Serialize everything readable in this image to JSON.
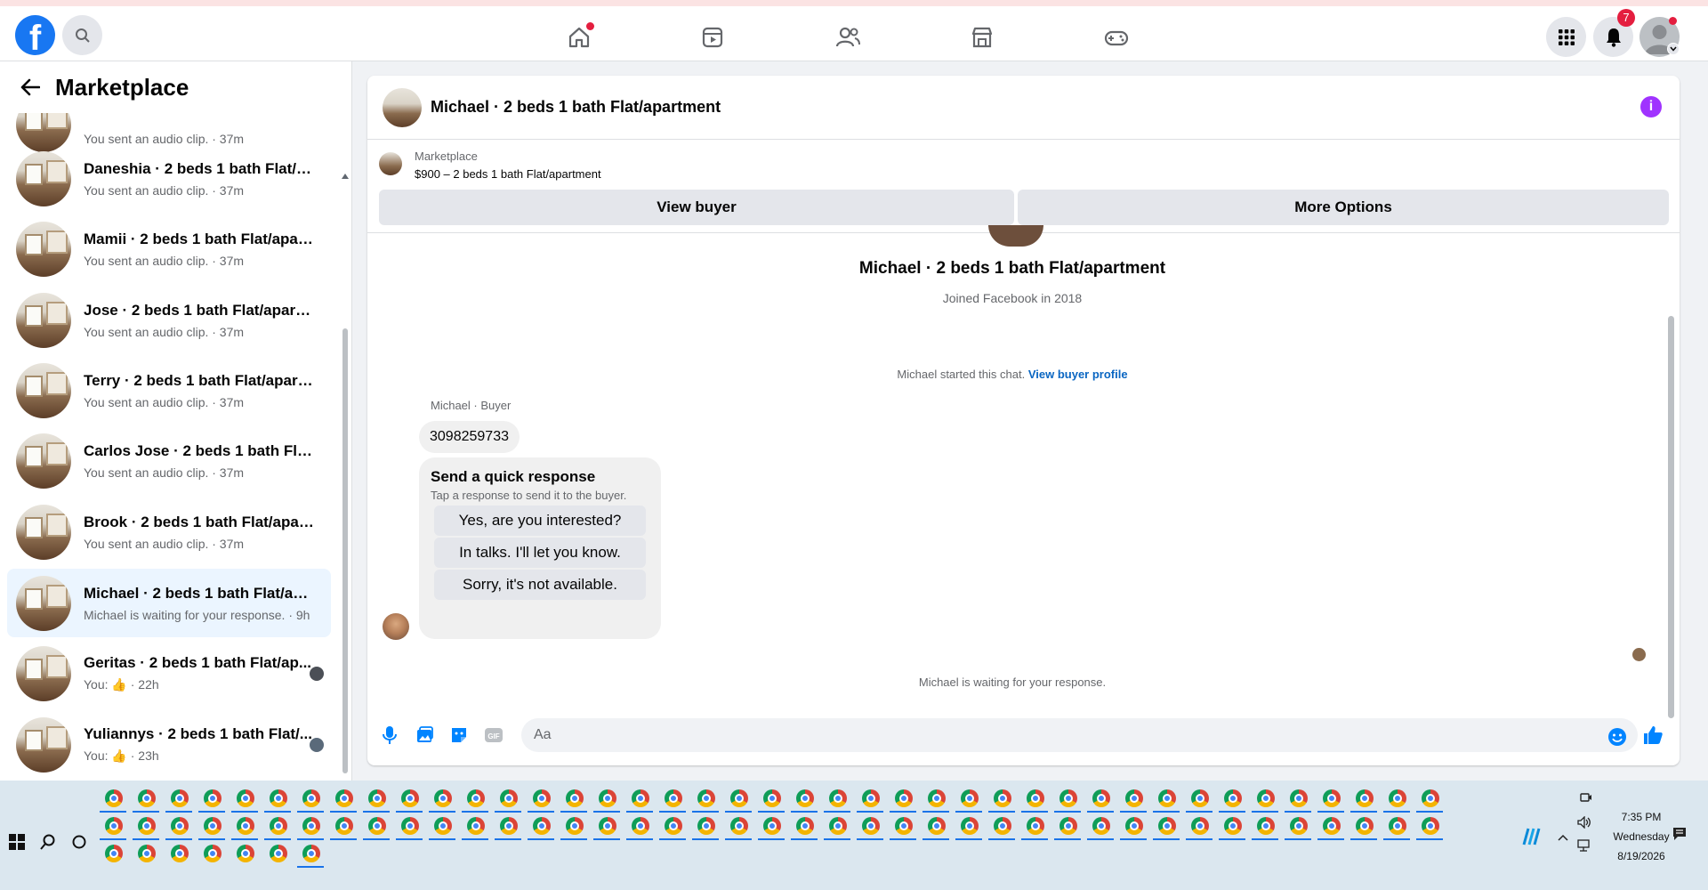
{
  "topbar": {
    "logo_letter": "f",
    "notification_count": "7"
  },
  "sidebar": {
    "title": "Marketplace",
    "items": [
      {
        "title": "",
        "subtitle": "You sent an audio clip. · 37m"
      },
      {
        "title": "Daneshia · 2 beds 1 bath Flat/ap...",
        "subtitle": "You sent an audio clip. · 37m"
      },
      {
        "title": "Mamii · 2 beds 1 bath Flat/apart...",
        "subtitle": "You sent an audio clip. · 37m"
      },
      {
        "title": "Jose · 2 beds 1 bath Flat/apartm...",
        "subtitle": "You sent an audio clip. · 37m"
      },
      {
        "title": "Terry · 2 beds 1 bath Flat/apartm...",
        "subtitle": "You sent an audio clip. · 37m"
      },
      {
        "title": "Carlos Jose · 2 beds 1 bath Flat/a...",
        "subtitle": "You sent an audio clip. · 37m"
      },
      {
        "title": "Brook · 2 beds 1 bath Flat/apart...",
        "subtitle": "You sent an audio clip. · 37m"
      },
      {
        "title": "Michael · 2 beds 1 bath Flat/apar...",
        "subtitle": "Michael is waiting for your response. · 9h"
      },
      {
        "title": "Geritas · 2 beds 1 bath Flat/ap...",
        "subtitle_prefix": "You:",
        "subtitle_time": "· 22h"
      },
      {
        "title": "Yuliannys · 2 beds 1 bath Flat/...",
        "subtitle_prefix": "You:",
        "subtitle_time": "· 23h"
      }
    ]
  },
  "chat": {
    "header_title": "Michael · 2 beds 1 bath Flat/apartment",
    "listing_source": "Marketplace",
    "listing_price": "$900 – 2 beds 1 bath Flat/apartment",
    "view_buyer": "View buyer",
    "more_options": "More Options",
    "profile_name": "Michael · 2 beds 1 bath Flat/apartment",
    "profile_joined": "Joined Facebook in 2018",
    "started_text": "Michael started this chat.",
    "view_profile_link": "View buyer profile",
    "sender_label": "Michael · Buyer",
    "message_number": "3098259733",
    "quick_title": "Send a quick response",
    "quick_sub": "Tap a response to send it to the buyer.",
    "quick_options": [
      "Yes, are you interested?",
      "In talks. I'll let you know.",
      "Sorry, it's not available."
    ],
    "waiting_text": "Michael is waiting for your response.",
    "composer_placeholder": "Aa"
  },
  "taskbar": {
    "time": "7:35 PM",
    "day": "Wednesday",
    "date": "8/19/2026"
  },
  "colors": {
    "brand": "#1877f2",
    "badge": "#e41e3f",
    "info": "#a033ff",
    "link": "#0a66c2",
    "active_item": "#ebf5ff"
  }
}
